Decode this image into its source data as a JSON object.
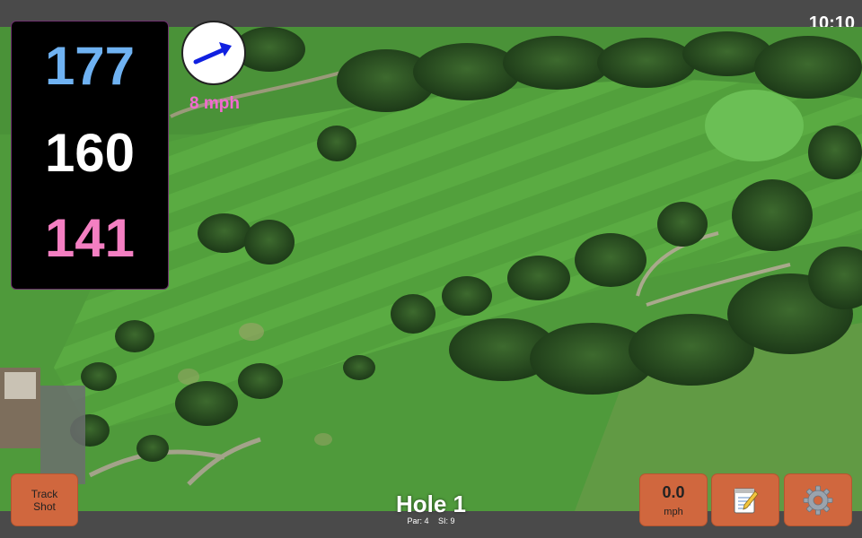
{
  "status_bar": {
    "time": "10:10"
  },
  "distances": {
    "back": "177",
    "center": "160",
    "front": "141",
    "colors": {
      "back": "#6fb2f2",
      "center": "#ffffff",
      "front": "#f47fc2"
    }
  },
  "wind": {
    "speed_label": "8 mph",
    "direction_icon": "arrow-right-icon",
    "arrow_color": "#1020e0"
  },
  "buttons": {
    "track_shot_label": "Track Shot",
    "speed_value": "0.0",
    "speed_unit": "mph",
    "notes_icon": "notepad-icon",
    "settings_icon": "gear-icon",
    "accent": "#d0673e"
  },
  "hole": {
    "title": "Hole 1",
    "par": "Par: 4",
    "stroke_index": "SI: 9"
  },
  "map": {
    "type": "satellite aerial golf course view"
  }
}
